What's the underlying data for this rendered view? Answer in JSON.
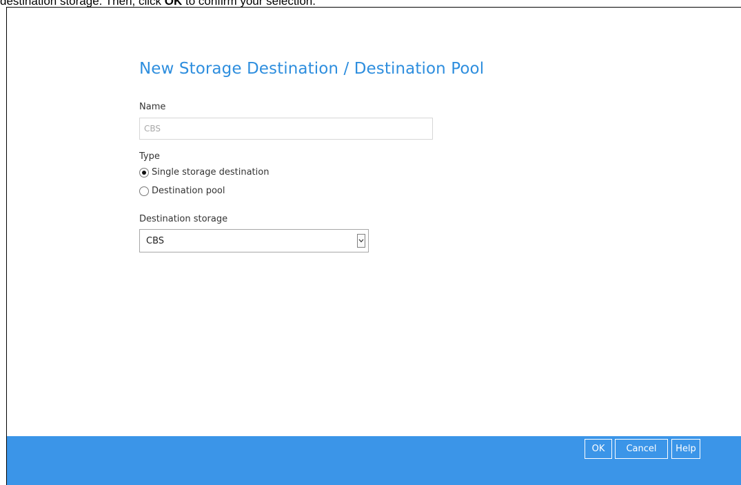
{
  "doc_caption": {
    "part1": "destination storage. Then, click ",
    "bold": "OK",
    "part2": " to confirm your selection."
  },
  "dialog": {
    "title": "New Storage Destination / Destination Pool",
    "name": {
      "label": "Name",
      "value": "CBS"
    },
    "type": {
      "label": "Type",
      "options": [
        {
          "label": "Single storage destination",
          "checked": true
        },
        {
          "label": "Destination pool",
          "checked": false
        }
      ]
    },
    "destination_storage": {
      "label": "Destination storage",
      "selected": "CBS"
    }
  },
  "footer": {
    "ok_label": "OK",
    "cancel_label": "Cancel",
    "help_label": "Help",
    "color": "#3b95e8"
  },
  "accent_color": "#2e8ede"
}
